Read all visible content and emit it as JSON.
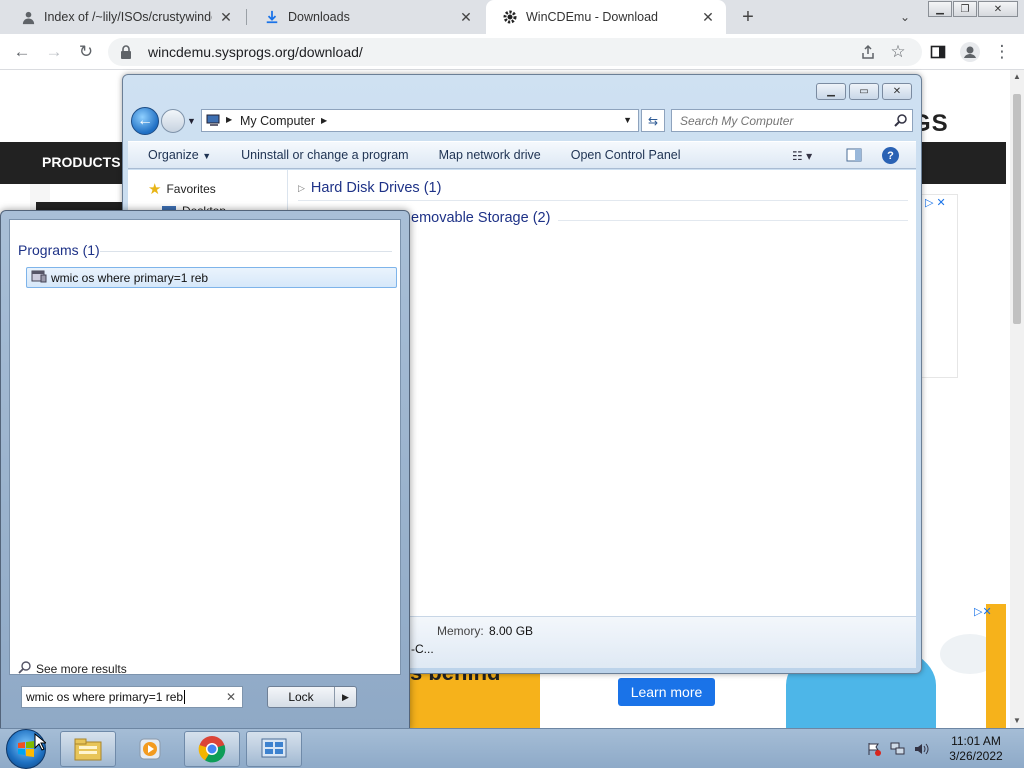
{
  "browser": {
    "tabs": [
      {
        "title": "Index of /~lily/ISOs/crustywindov",
        "icon": "folder-icon"
      },
      {
        "title": "Downloads",
        "icon": "download-icon"
      },
      {
        "title": "WinCDEmu - Download",
        "icon": "gear-icon"
      }
    ],
    "active_tab": 2,
    "url": "wincdemu.sysprogs.org/download/"
  },
  "website": {
    "nav_products": "PRODUCTS",
    "logo_tail": "GS",
    "ad_banner_text": "s behind",
    "ad_button": "Learn more"
  },
  "explorer": {
    "breadcrumb": "My Computer",
    "search_placeholder": "Search My Computer",
    "commands": {
      "organize": "Organize",
      "uninstall": "Uninstall or change a program",
      "map_drive": "Map network drive",
      "control_panel": "Open Control Panel"
    },
    "nav": {
      "favorites": "Favorites",
      "desktop": "Desktop"
    },
    "groups": {
      "hard_disk": "Hard Disk Drives (1)",
      "removable": "emovable Storage (2)"
    },
    "details": {
      "memory_label": "Memory:",
      "memory_value": "8.00 GB",
      "cpu_fragment": "-C..."
    }
  },
  "start_menu": {
    "programs_header": "Programs (1)",
    "result_label": "wmic os where primary=1 reb",
    "see_more": "See more results",
    "search_value": "wmic os where primary=1 reb",
    "lock_button": "Lock"
  },
  "taskbar": {
    "time": "11:01 AM",
    "date": "3/26/2022",
    "items": [
      "explorer-icon",
      "media-player-icon",
      "chrome-icon",
      "control-panel-icon"
    ]
  },
  "colors": {
    "chrome_tabbar": "#dee1e6",
    "site_header": "#222222",
    "explorer_frame": "#cfe1f2",
    "explorer_link": "#1e3287",
    "ad_button": "#1a73e8",
    "ad_accent": "#f6b21b"
  }
}
